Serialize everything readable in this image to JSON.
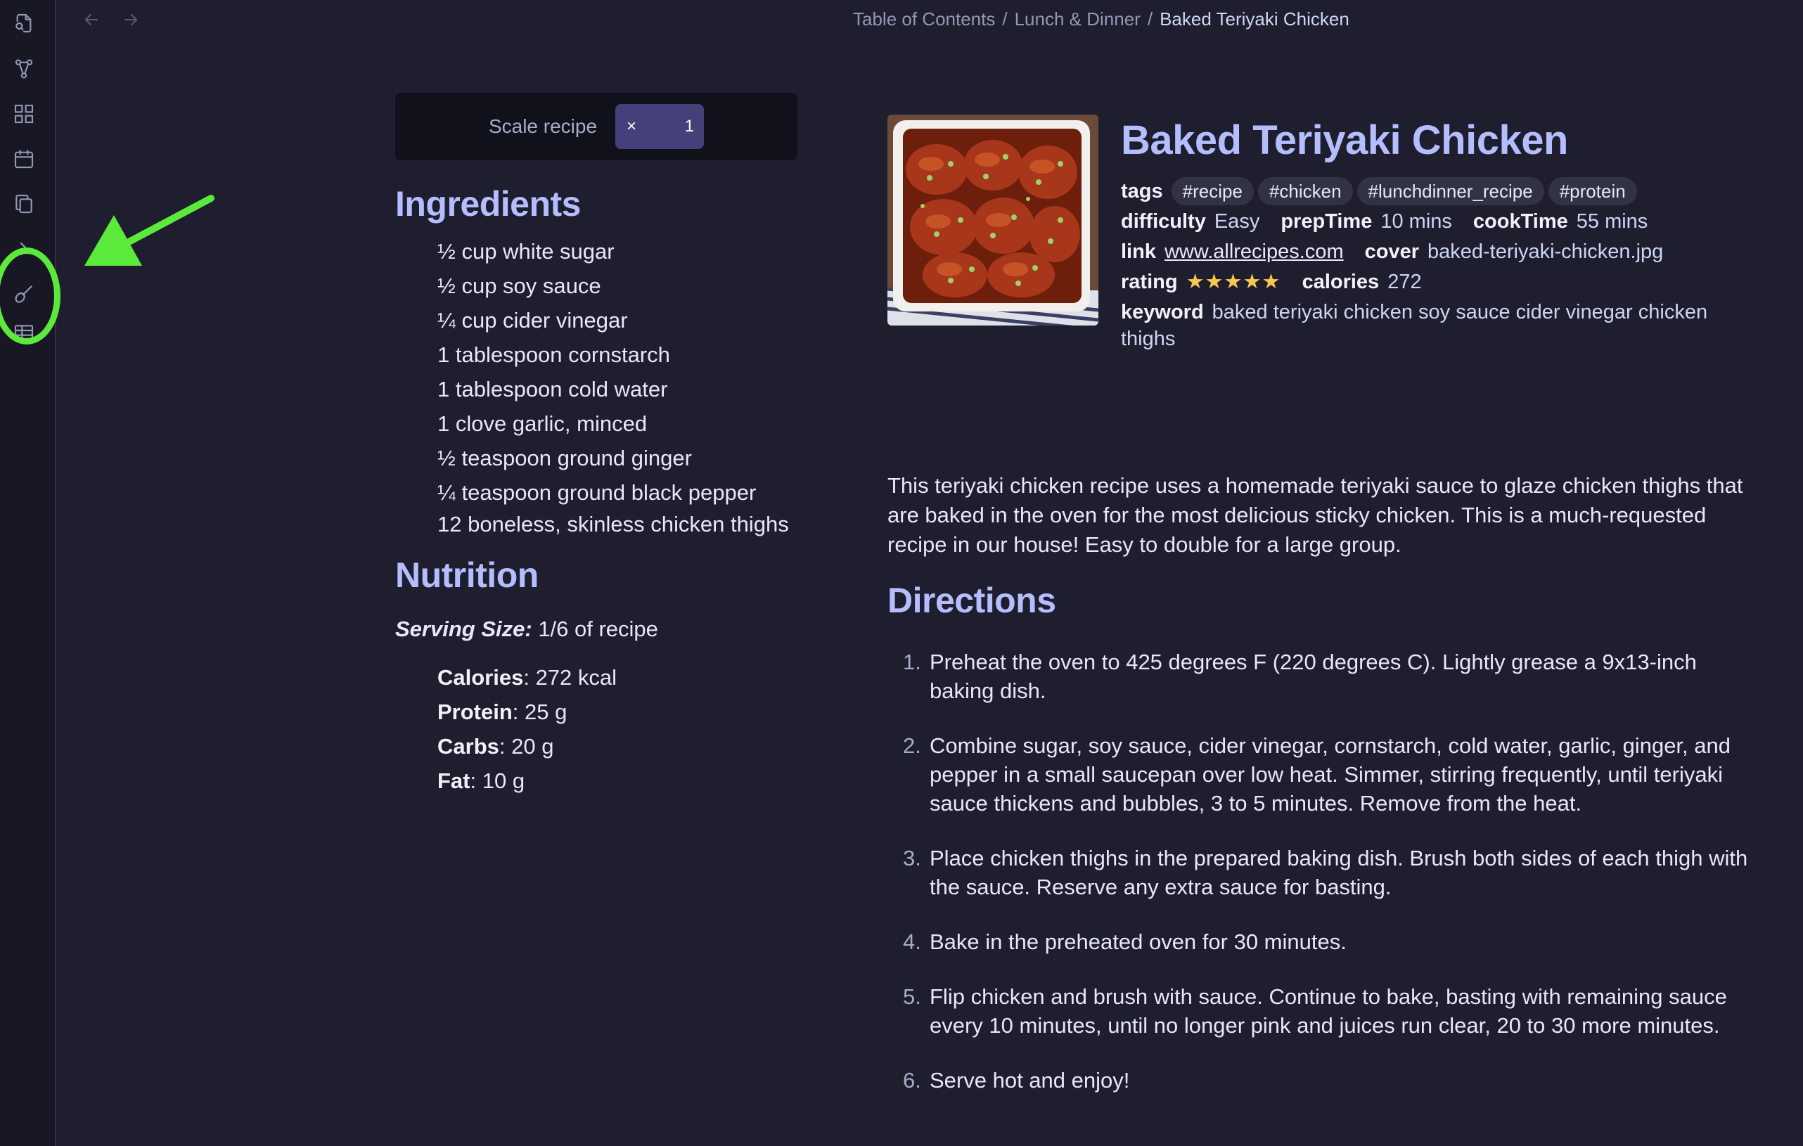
{
  "breadcrumb": {
    "items": [
      "Table of Contents",
      "Lunch & Dinner"
    ],
    "separator": "/",
    "current": "Baked Teriyaki Chicken"
  },
  "ribbon": {
    "icons": [
      "file-search-icon",
      "graph-icon",
      "layout-grid-icon",
      "calendar-icon",
      "copy-icon",
      "chevron-right-icon",
      "whisk-icon",
      "table-icon"
    ],
    "highlight_color": "#5bea3c"
  },
  "scale": {
    "label": "Scale recipe",
    "multiplier": "×",
    "value": "1"
  },
  "ingredients": {
    "heading": "Ingredients",
    "items": [
      "½ cup white sugar",
      "½ cup soy sauce",
      "¼ cup cider vinegar",
      "1 tablespoon cornstarch",
      "1 tablespoon cold water",
      "1 clove garlic, minced",
      "½ teaspoon ground ginger",
      "¼ teaspoon ground black pepper",
      "12 boneless, skinless chicken thighs"
    ]
  },
  "nutrition": {
    "heading": "Nutrition",
    "serving_label": "Serving Size:",
    "serving_value": "1/6 of recipe",
    "items": [
      {
        "label": "Calories",
        "value": ": 272 kcal"
      },
      {
        "label": "Protein",
        "value": ": 25 g"
      },
      {
        "label": "Carbs",
        "value": ": 20 g"
      },
      {
        "label": "Fat",
        "value": ": 10 g"
      }
    ]
  },
  "recipe": {
    "title": "Baked Teriyaki Chicken",
    "tags_label": "tags",
    "tags": [
      "#recipe",
      "#chicken",
      "#lunchdinner_recipe",
      "#protein"
    ],
    "difficulty_label": "difficulty",
    "difficulty": "Easy",
    "prep_label": "prepTime",
    "prep": "10 mins",
    "cook_label": "cookTime",
    "cook": "55 mins",
    "link_label": "link",
    "link": "www.allrecipes.com",
    "cover_label": "cover",
    "cover": "baked-teriyaki-chicken.jpg",
    "rating_label": "rating",
    "rating": "★★★★★",
    "rating_value": 5,
    "calories_label": "calories",
    "calories": "272",
    "keyword_label": "keyword",
    "keyword": "baked teriyaki chicken soy sauce cider vinegar chicken thighs",
    "description": "This teriyaki chicken recipe uses a homemade teriyaki sauce to glaze chicken thighs that are baked in the oven for the most delicious sticky chicken. This is a much-requested recipe in our house! Easy to double for a large group."
  },
  "directions": {
    "heading": "Directions",
    "steps": [
      "Preheat the oven to 425 degrees F (220 degrees C). Lightly grease a 9x13-inch baking dish.",
      "Combine sugar, soy sauce, cider vinegar, cornstarch, cold water, garlic, ginger, and pepper in a small saucepan over low heat. Simmer, stirring frequently, until teriyaki sauce thickens and bubbles, 3 to 5 minutes. Remove from the heat.",
      "Place chicken thighs in the prepared baking dish. Brush both sides of each thigh with the sauce. Reserve any extra sauce for basting.",
      "Bake in the preheated oven for 30 minutes.",
      "Flip chicken and brush with sauce. Continue to bake, basting with remaining sauce every 10 minutes, until no longer pink and juices run clear, 20 to 30 more minutes.",
      "Serve hot and enjoy!"
    ],
    "numbers": [
      "1.",
      "2.",
      "3.",
      "4.",
      "5.",
      "6."
    ]
  },
  "colors": {
    "accent": "#b4befe",
    "background": "#1e1e2e",
    "scale_input": "#45407a",
    "stars": "#f9c74f",
    "annotation": "#5bea3c"
  }
}
